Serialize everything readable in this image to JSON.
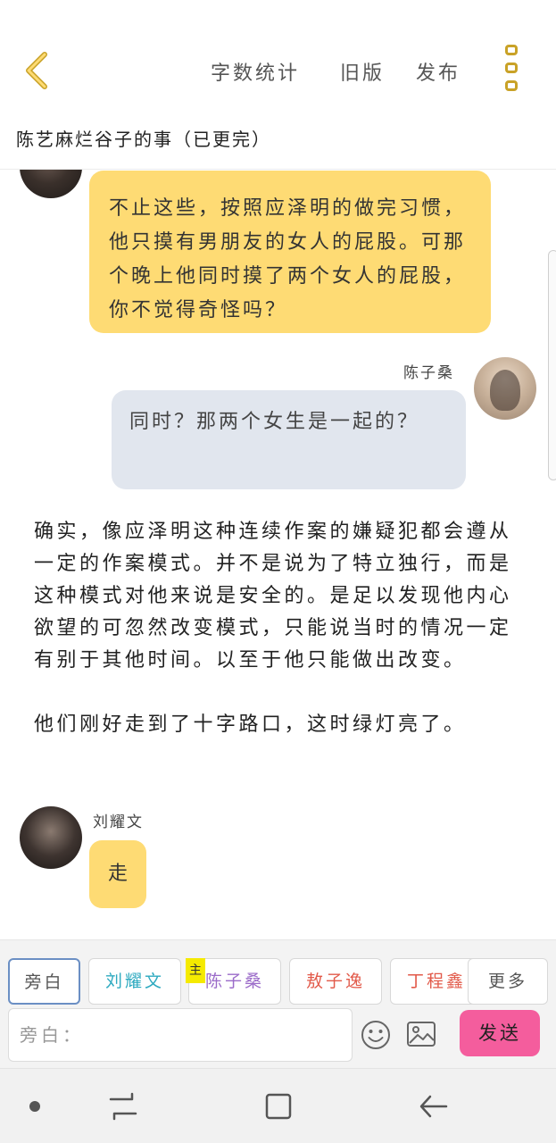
{
  "header": {
    "back_icon": "chevron-left-icon",
    "word_count_label": "字数统计",
    "old_version_label": "旧版",
    "publish_label": "发布",
    "more_icon": "vertical-dots-icon",
    "accent_color": "#c9a227",
    "story_title": "陈艺麻烂谷子的事（已更完）"
  },
  "messages": {
    "top_bubble_text": "不止这些，按照应泽明的做完习惯，他只摸有男朋友的女人的屁股。可那个晚上他同时摸了两个女人的屁股，你不觉得奇怪吗？",
    "chenzisang_name": "陈子桑",
    "chenzisang_text": "同时？那两个女生是一起的？",
    "narration_text": "确实，像应泽明这种连续作案的嫌疑犯都会遵从一定的作案模式。并不是说为了特立独行，而是这种模式对他来说是安全的。是足以发现他内心欲望的可忽然改变模式，只能说当时的情况一定有别于其他时间。以至于他只能做出改变。\n\n他们刚好走到了十字路口，这时绿灯亮了。",
    "liuyaowen_name": "刘耀文",
    "liuyaowen_text": "走",
    "yellow_bubble_color": "#fedb74",
    "blue_bubble_color": "#e1e6ee"
  },
  "composer": {
    "roles": [
      {
        "label": "旁白"
      },
      {
        "label": "刘耀文"
      },
      {
        "label": "陈子桑"
      },
      {
        "label": "敖子逸"
      },
      {
        "label": "丁程鑫"
      }
    ],
    "main_badge": "主",
    "more_roles_label": "更多",
    "input_placeholder": "旁白：",
    "emoji_icon": "smiley-icon",
    "image_icon": "image-icon",
    "send_label": "发送",
    "send_color": "#f45d9d"
  },
  "system_nav": {
    "recents_icon": "recents-icon",
    "home_icon": "home-icon",
    "back_icon": "back-arrow-icon"
  }
}
